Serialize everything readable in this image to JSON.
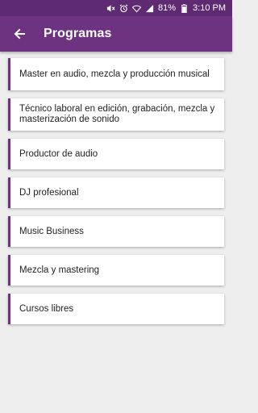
{
  "status_bar": {
    "battery": "81%",
    "time": "3:10 PM",
    "icons": [
      "mute-icon",
      "alarm-icon",
      "wifi-icon",
      "signal-icon",
      "battery-icon"
    ]
  },
  "app_bar": {
    "title": "Programas",
    "back_icon": "arrow-back-icon"
  },
  "programs": [
    "Master en audio, mezcla y producción musical",
    "Técnico laboral en edición, grabación, mezcla y masterización de sonido",
    "Productor de audio",
    "DJ profesional",
    "Music Business",
    "Mezcla y mastering",
    "Cursos libres"
  ],
  "colors": {
    "status_bar": "#5e2a72",
    "app_bar": "#6d3381",
    "accent": "#6d3381",
    "background": "#eeeeee"
  }
}
